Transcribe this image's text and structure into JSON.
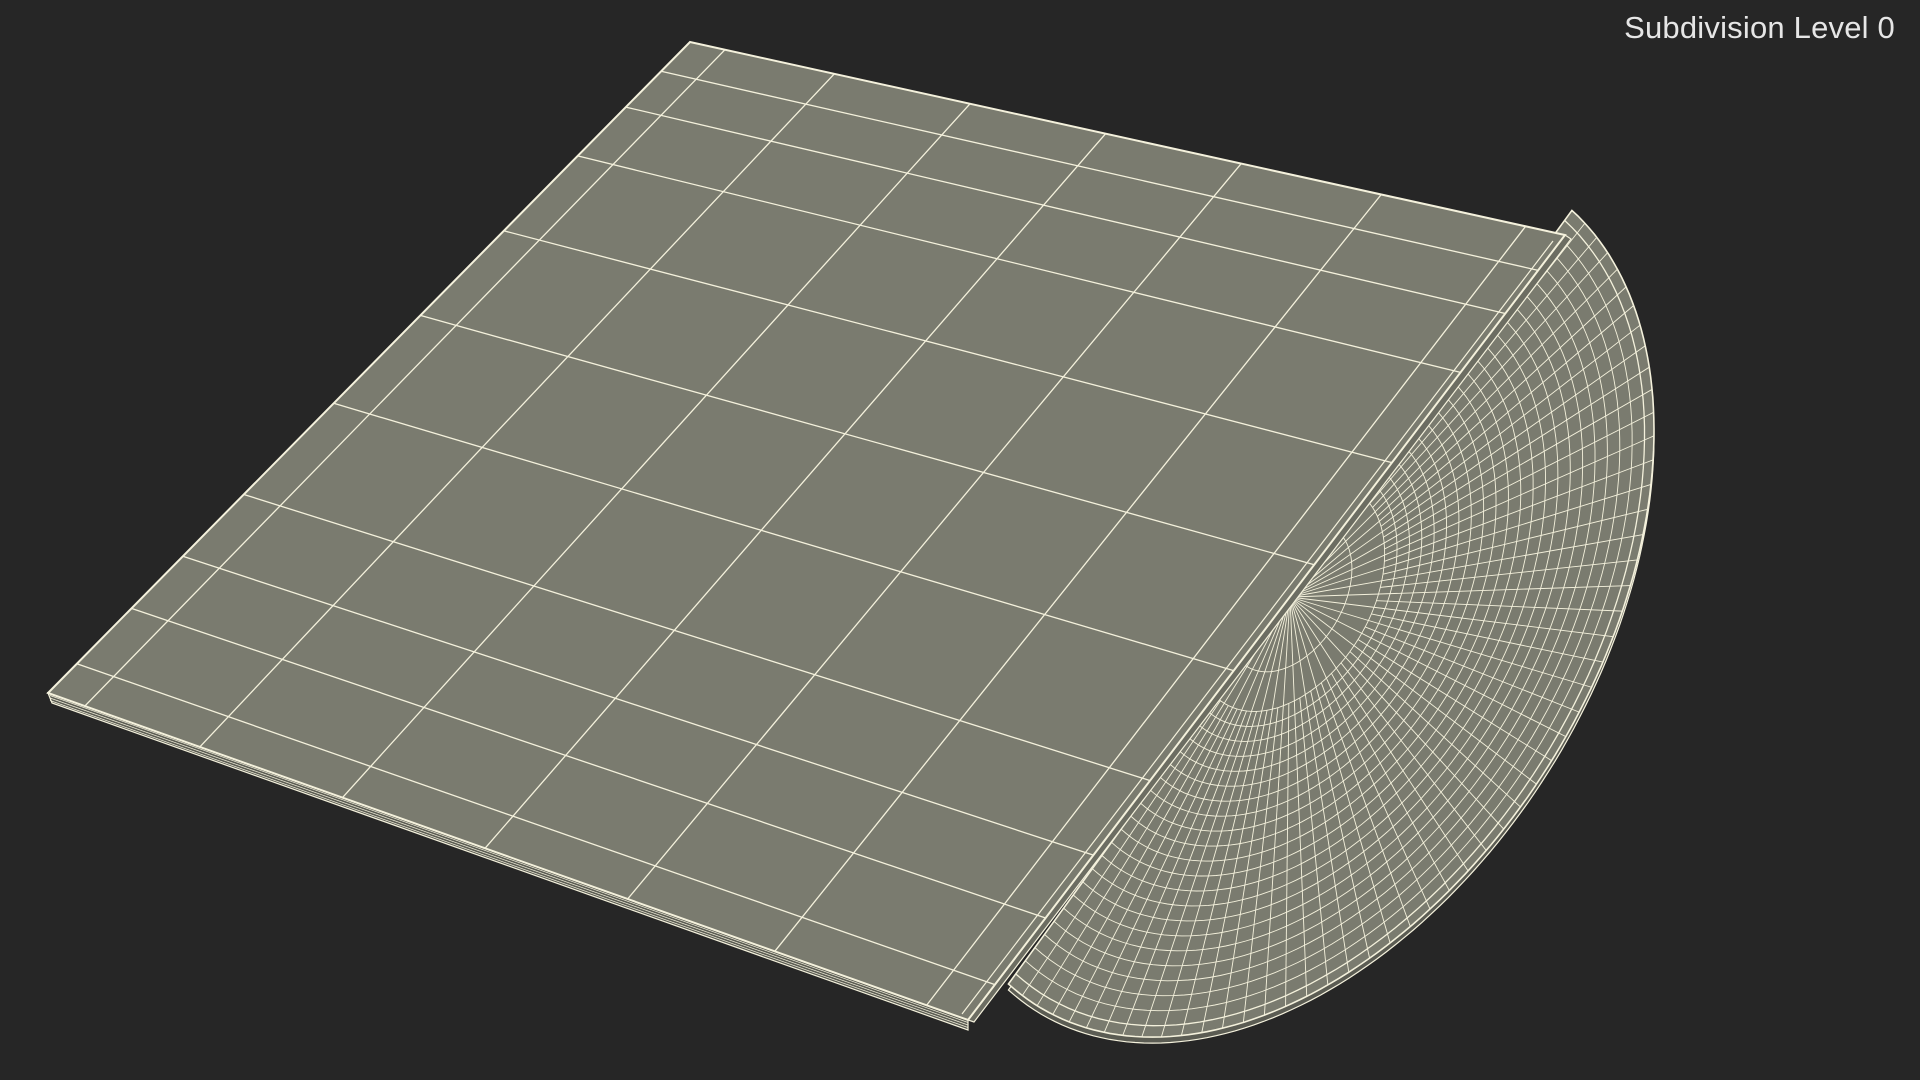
{
  "viewport": {
    "overlay_label": "Subdivision Level 0",
    "background_color": "#262626"
  },
  "model": {
    "surface_color": "#7a7b6f",
    "wire_color": "#f4f1dc",
    "parts": [
      "square-sleeve",
      "round-disc"
    ]
  }
}
